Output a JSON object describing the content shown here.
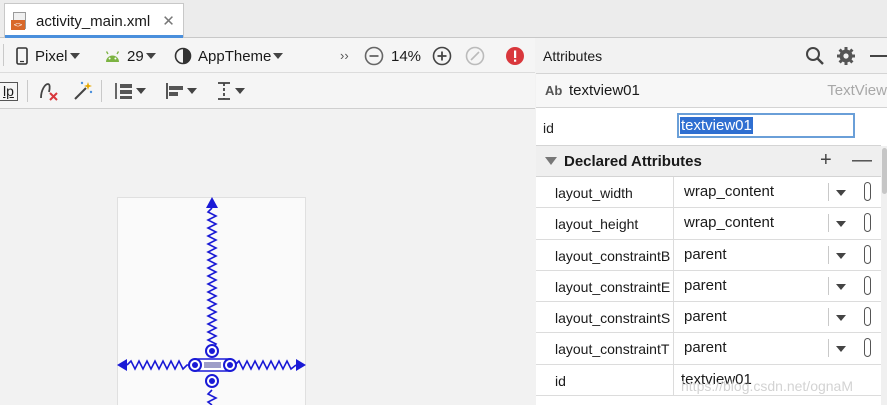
{
  "tab": {
    "title": "activity_main.xml",
    "close": "✕"
  },
  "toolbar": {
    "device": "Pixel",
    "api": "29",
    "theme": "AppTheme",
    "more": "››",
    "zoom": "14%",
    "margin": "lp"
  },
  "attributes": {
    "title": "Attributes",
    "component_prefix": "Ab",
    "component_name": "textview01",
    "component_type": "TextView",
    "id_label": "id",
    "id_value": "textview01",
    "declared_title": "Declared Attributes",
    "plus": "+",
    "minus": "—",
    "rows": [
      {
        "key": "layout_width",
        "value": "wrap_content"
      },
      {
        "key": "layout_height",
        "value": "wrap_content"
      },
      {
        "key": "layout_constraintB",
        "value": "parent"
      },
      {
        "key": "layout_constraintE",
        "value": "parent"
      },
      {
        "key": "layout_constraintS",
        "value": "parent"
      },
      {
        "key": "layout_constraintT",
        "value": "parent"
      },
      {
        "key": "id",
        "value": "textview01"
      }
    ]
  },
  "watermark": "https://blog.csdn.net/ognaM",
  "colors": {
    "accent": "#4a8fdc",
    "selection": "#2f6fd1",
    "constraint": "#1a1ad6",
    "error": "#d9373c"
  }
}
